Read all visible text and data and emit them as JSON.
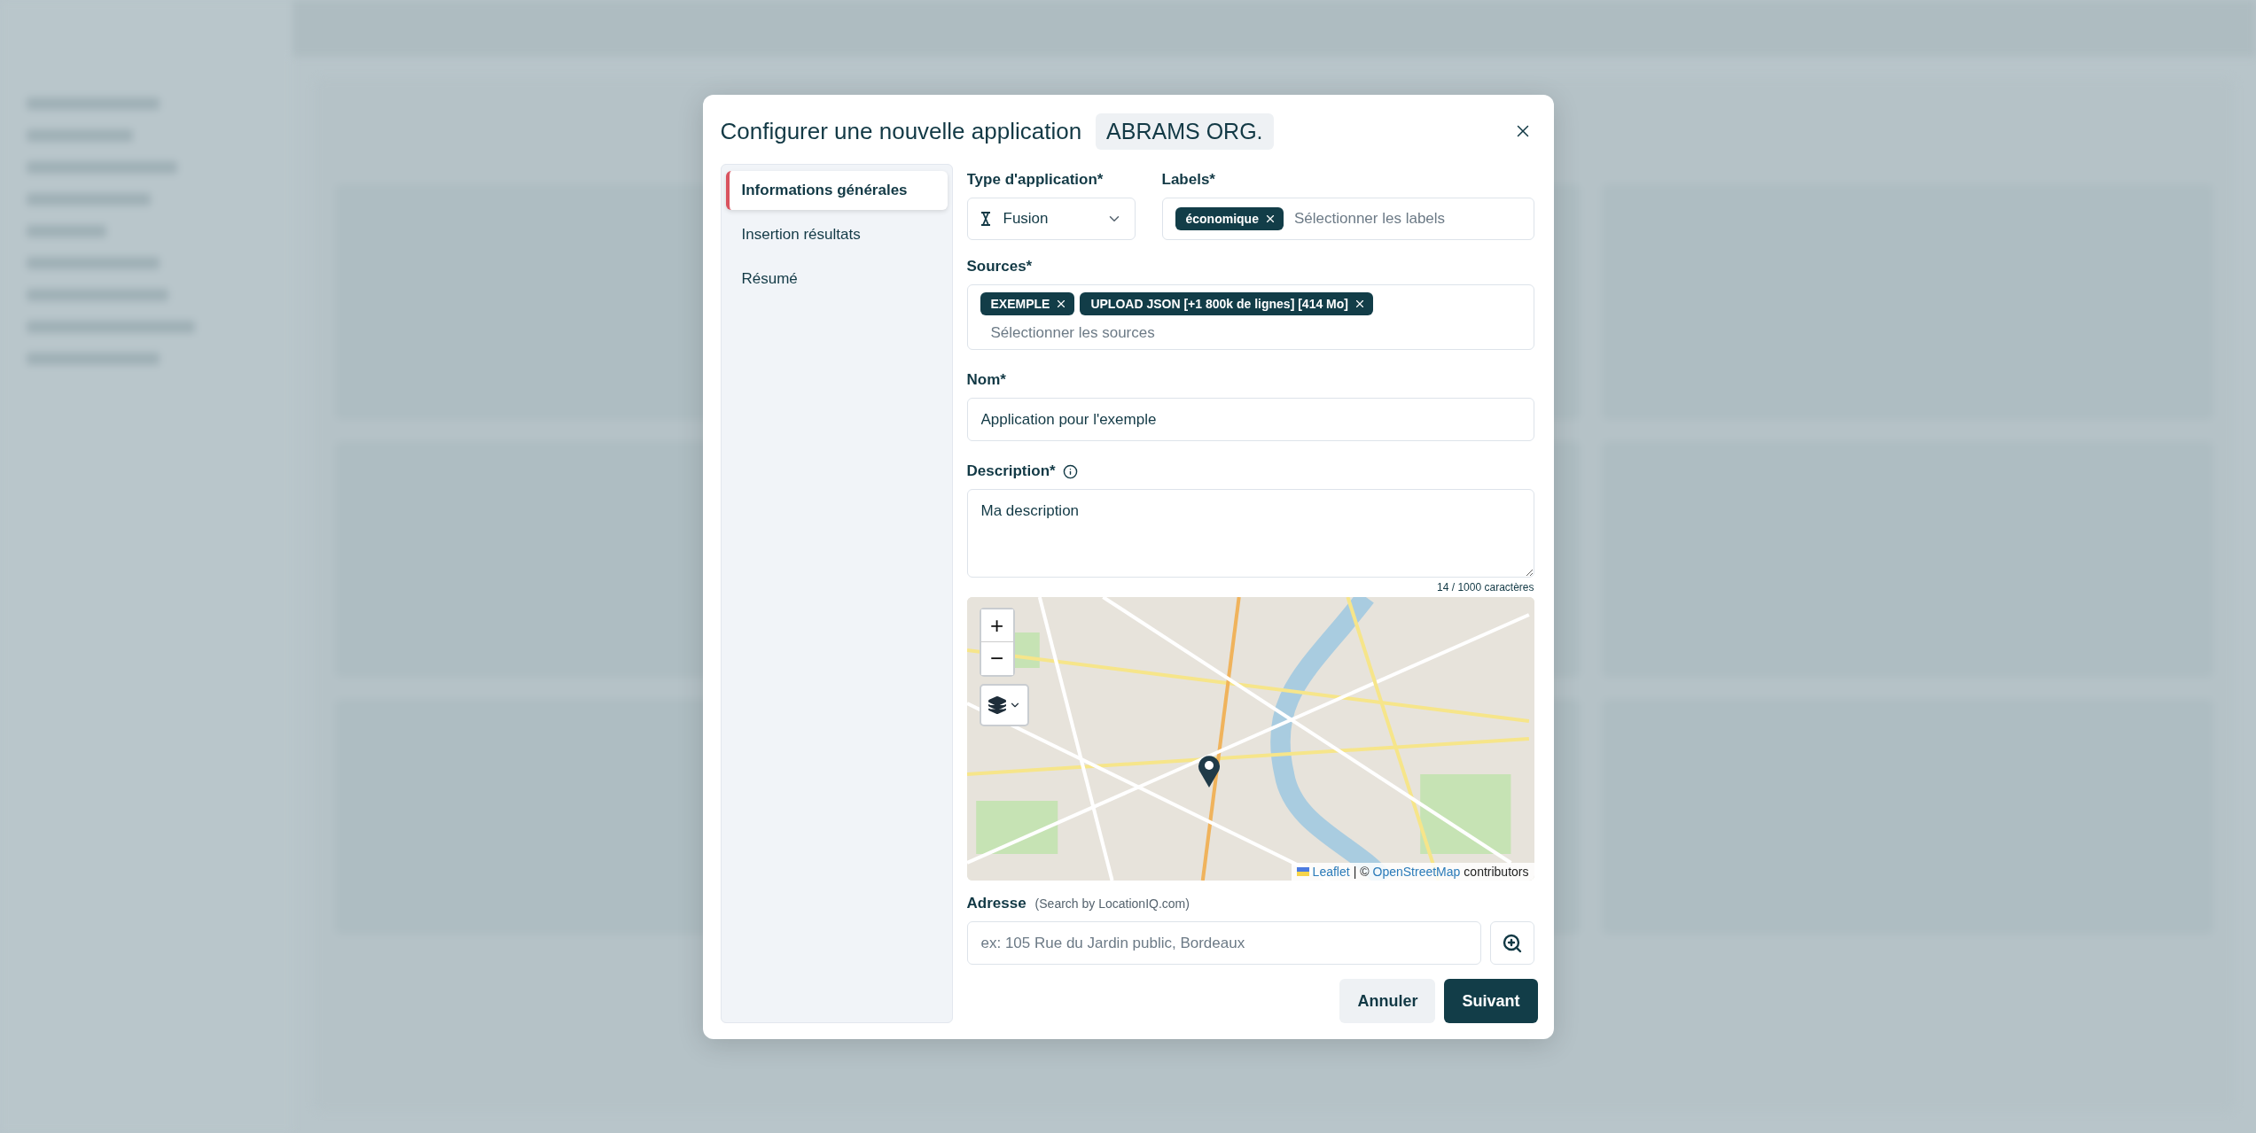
{
  "modal": {
    "title": "Configurer une nouvelle application",
    "org_badge": "ABRAMS ORG.",
    "steps": [
      {
        "label": "Informations générales",
        "selected": true
      },
      {
        "label": "Insertion résultats",
        "selected": false
      },
      {
        "label": "Résumé",
        "selected": false
      }
    ],
    "app_type": {
      "label": "Type d'application*",
      "value": "Fusion"
    },
    "labels": {
      "label": "Labels*",
      "chips": [
        "économique"
      ],
      "placeholder": "Sélectionner les labels"
    },
    "sources": {
      "label": "Sources*",
      "chips": [
        "EXEMPLE",
        "UPLOAD JSON [+1 800k de lignes] [414 Mo]"
      ],
      "placeholder": "Sélectionner les sources"
    },
    "name": {
      "label": "Nom*",
      "value": "Application pour l'exemple"
    },
    "description": {
      "label": "Description*",
      "value": "Ma description",
      "counter": "14 / 1000 caractères"
    },
    "map": {
      "zoom_in": "+",
      "zoom_out": "−",
      "attribution_link": "Leaflet",
      "attribution_sep": "| ©",
      "attribution_osm": "OpenStreetMap",
      "attribution_tail": "contributors"
    },
    "address": {
      "label": "Adresse",
      "hint": "(Search by LocationIQ.com)",
      "placeholder": "ex: 105 Rue du Jardin public, Bordeaux"
    },
    "buttons": [
      {
        "label": "Annuler",
        "kind": "secondary"
      },
      {
        "label": "Suivant",
        "kind": "primary"
      }
    ]
  }
}
